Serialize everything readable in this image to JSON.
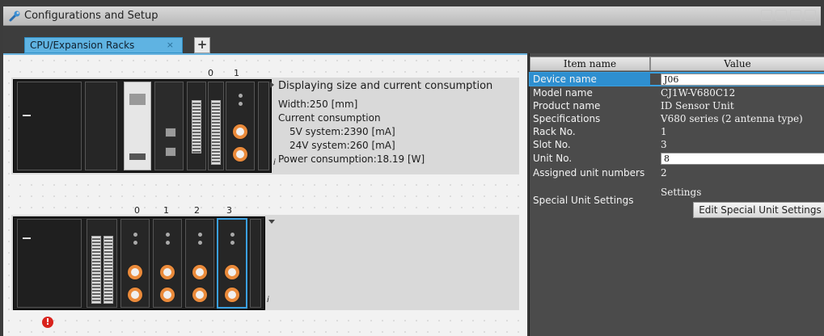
{
  "window": {
    "title": "Configurations and Setup"
  },
  "tabs": [
    {
      "label": "CPU/Expansion Racks",
      "close": "×"
    }
  ],
  "add_tab": "+",
  "rack1": {
    "slots": [
      "0",
      "1"
    ],
    "info_title": "Displaying size and current consumption",
    "width": "Width:250 [mm]",
    "current": "Current consumption",
    "v5": "5V system:2390 [mA]",
    "v24": "24V system:260 [mA]",
    "power": "Power consumption:18.19 [W]"
  },
  "rack2": {
    "slots": [
      "0",
      "1",
      "2",
      "3"
    ]
  },
  "info_marker": "i",
  "error_icon": "!",
  "properties": {
    "header_name": "Item name",
    "header_value": "Value",
    "rows": [
      {
        "name": "Device name",
        "value": "J06"
      },
      {
        "name": "Model name",
        "value": "CJ1W-V680C12"
      },
      {
        "name": "Product name",
        "value": "ID Sensor Unit"
      },
      {
        "name": "Specifications",
        "value": "V680 series (2 antenna type)"
      },
      {
        "name": "Rack No.",
        "value": "1"
      },
      {
        "name": "Slot No.",
        "value": "3"
      },
      {
        "name": "Unit No.",
        "value": "8"
      },
      {
        "name": "Assigned unit numbers",
        "value": "2"
      },
      {
        "name": "Special Unit Settings",
        "value": "Settings"
      }
    ],
    "edit_button": "Edit Special Unit Settings"
  },
  "colors": {
    "accent": "#5fb3e2",
    "selection": "#2e8fd0",
    "dial": "#ea8a3a",
    "error": "#d9221c"
  }
}
